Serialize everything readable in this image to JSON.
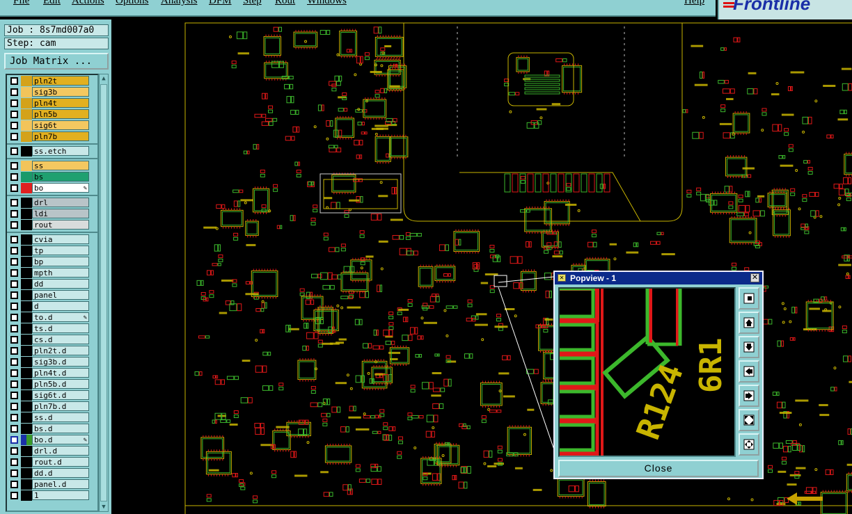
{
  "menu": {
    "items": [
      {
        "label": "File",
        "x": 0
      },
      {
        "label": "Edit",
        "x": 0
      },
      {
        "label": "Actions",
        "x": 0
      },
      {
        "label": "Options",
        "x": 0
      },
      {
        "label": "Analysis",
        "x": 0
      },
      {
        "label": "DFM",
        "x": 0
      },
      {
        "label": "Step",
        "x": 0
      },
      {
        "label": "Rout",
        "x": 0
      },
      {
        "label": "Windows",
        "x": 0
      },
      {
        "label": "Help",
        "x": 0
      }
    ]
  },
  "logo": {
    "text": "Frontline"
  },
  "job": {
    "label": "Job : 8s7md007a0"
  },
  "step": {
    "label": "Step: cam"
  },
  "job_matrix": {
    "label": "Job Matrix ..."
  },
  "layers": [
    {
      "name": "pln2t",
      "color": "#d4a21a",
      "bg": "#e2b020"
    },
    {
      "name": "sig3b",
      "color": "#f2c45a",
      "bg": "#f4c860"
    },
    {
      "name": "pln4t",
      "color": "#d4a21a",
      "bg": "#e2b020"
    },
    {
      "name": "pln5b",
      "color": "#d4a21a",
      "bg": "#e2b020"
    },
    {
      "name": "sig6t",
      "color": "#f2c45a",
      "bg": "#f4c860"
    },
    {
      "name": "pln7b",
      "color": "#d4a21a",
      "bg": "#e2b020"
    },
    {
      "name": "ss.etch",
      "color": "#000000",
      "bg": "#c8e8e8"
    },
    {
      "name": "ss",
      "color": "#f2c45a",
      "bg": "#f4c860"
    },
    {
      "name": "bs",
      "color": "#1a9a6a",
      "bg": "#1fa070"
    },
    {
      "name": "bo",
      "color": "#e02020",
      "bg": "#ffffff",
      "edit": true
    },
    {
      "name": "drl",
      "color": "#000000",
      "bg": "#b8c4c8"
    },
    {
      "name": "ldi",
      "color": "#000000",
      "bg": "#b8c4c8"
    },
    {
      "name": "rout",
      "color": "#000000",
      "bg": "#d8dcdc"
    },
    {
      "name": "cvia",
      "color": "#000000",
      "bg": "#c8e8e8"
    },
    {
      "name": "tp",
      "color": "#000000",
      "bg": "#c8e8e8"
    },
    {
      "name": "bp",
      "color": "#000000",
      "bg": "#c8e8e8"
    },
    {
      "name": "mpth",
      "color": "#000000",
      "bg": "#c8e8e8"
    },
    {
      "name": "dd",
      "color": "#000000",
      "bg": "#c8e8e8"
    },
    {
      "name": "panel",
      "color": "#000000",
      "bg": "#c8e8e8"
    },
    {
      "name": "d",
      "color": "#000000",
      "bg": "#c8e8e8"
    },
    {
      "name": "to.d",
      "color": "#000000",
      "bg": "#c8e8e8",
      "edit": true
    },
    {
      "name": "ts.d",
      "color": "#000000",
      "bg": "#c8e8e8"
    },
    {
      "name": "cs.d",
      "color": "#000000",
      "bg": "#c8e8e8"
    },
    {
      "name": "pln2t.d",
      "color": "#000000",
      "bg": "#c8e8e8"
    },
    {
      "name": "sig3b.d",
      "color": "#000000",
      "bg": "#c8e8e8"
    },
    {
      "name": "pln4t.d",
      "color": "#000000",
      "bg": "#c8e8e8"
    },
    {
      "name": "pln5b.d",
      "color": "#000000",
      "bg": "#c8e8e8"
    },
    {
      "name": "sig6t.d",
      "color": "#000000",
      "bg": "#c8e8e8"
    },
    {
      "name": "pln7b.d",
      "color": "#000000",
      "bg": "#c8e8e8"
    },
    {
      "name": "ss.d",
      "color": "#000000",
      "bg": "#c8e8e8"
    },
    {
      "name": "bs.d",
      "color": "#000000",
      "bg": "#c8e8e8"
    },
    {
      "name": "bo.d",
      "color": "#3a9a2a",
      "bg": "#c8e8e8",
      "edit": true,
      "active": true
    },
    {
      "name": "drl.d",
      "color": "#000000",
      "bg": "#c8e8e8"
    },
    {
      "name": "rout.d",
      "color": "#000000",
      "bg": "#c8e8e8"
    },
    {
      "name": "dd.d",
      "color": "#000000",
      "bg": "#c8e8e8"
    },
    {
      "name": "panel.d",
      "color": "#000000",
      "bg": "#c8e8e8"
    },
    {
      "name": "1",
      "color": "#000000",
      "bg": "#c8e8e8"
    }
  ],
  "popview": {
    "title": "Popview - 1",
    "close_label": "Close",
    "text_lines": [
      "R124",
      "6R1"
    ]
  },
  "colors": {
    "board_bg": "#000000",
    "trace_red": "#e01818",
    "trace_green": "#3cb82c",
    "silk_yellow": "#c8b400",
    "panel_bg": "#8fd0d2"
  }
}
